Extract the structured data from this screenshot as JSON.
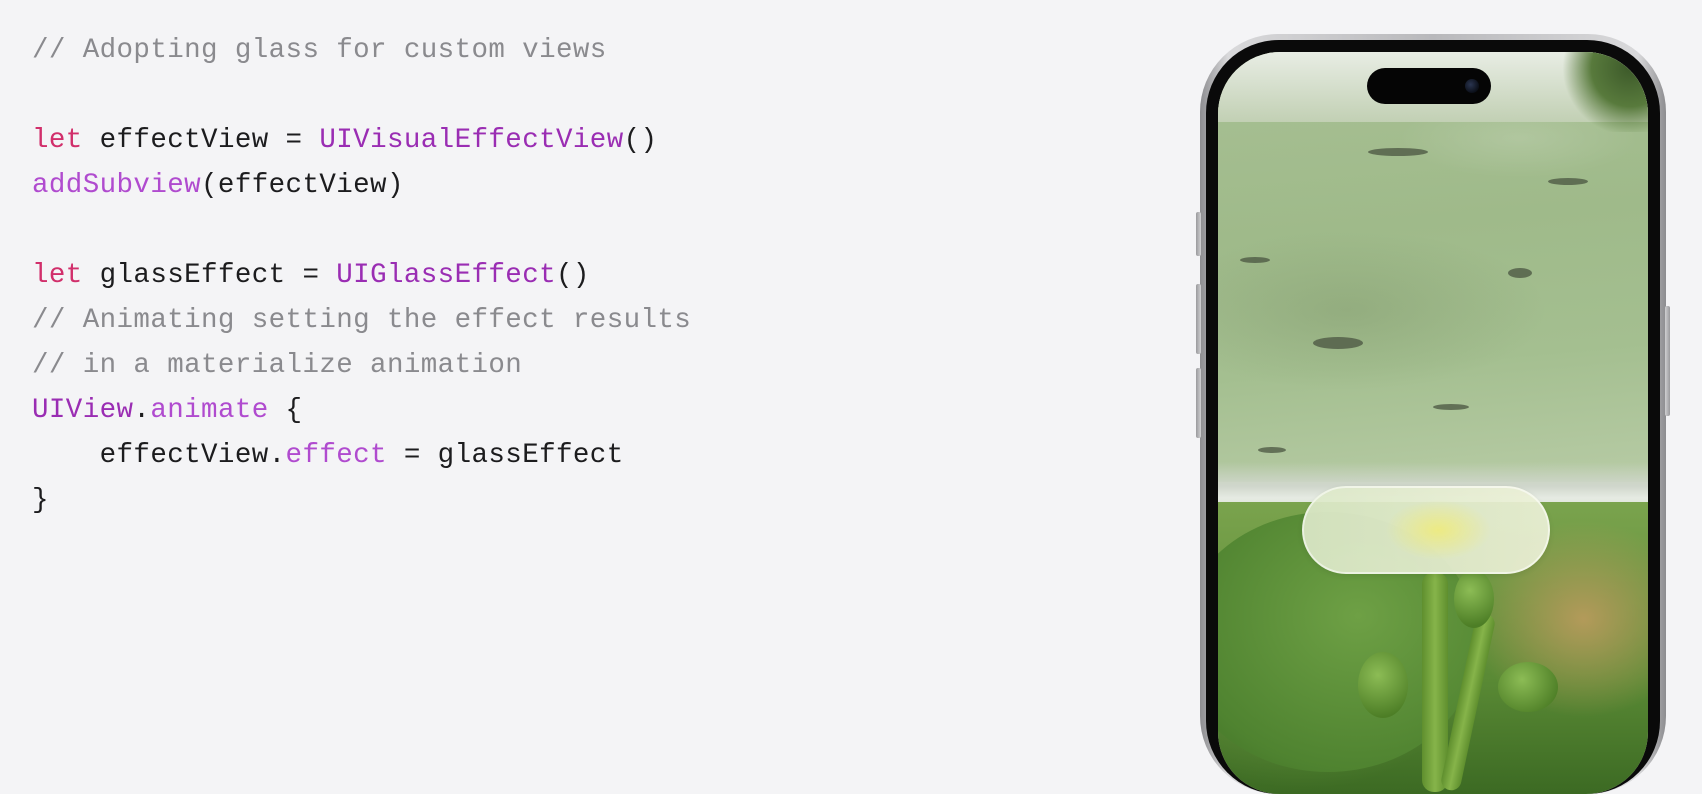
{
  "code": {
    "lines": [
      [
        {
          "t": "// Adopting glass for custom views",
          "c": "comment"
        }
      ],
      [],
      [
        {
          "t": "let",
          "c": "keyword"
        },
        {
          "t": " effectView = ",
          "c": "plain"
        },
        {
          "t": "UIVisualEffectView",
          "c": "type"
        },
        {
          "t": "()",
          "c": "plain"
        }
      ],
      [
        {
          "t": "addSubview",
          "c": "func"
        },
        {
          "t": "(effectView)",
          "c": "plain"
        }
      ],
      [],
      [
        {
          "t": "let",
          "c": "keyword"
        },
        {
          "t": " glassEffect = ",
          "c": "plain"
        },
        {
          "t": "UIGlassEffect",
          "c": "type"
        },
        {
          "t": "()",
          "c": "plain"
        }
      ],
      [
        {
          "t": "// Animating setting the effect results",
          "c": "comment"
        }
      ],
      [
        {
          "t": "// in a materialize animation",
          "c": "comment"
        }
      ],
      [
        {
          "t": "UIView",
          "c": "type"
        },
        {
          "t": ".",
          "c": "plain"
        },
        {
          "t": "animate",
          "c": "func"
        },
        {
          "t": " {",
          "c": "plain"
        }
      ],
      [
        {
          "t": "    effectView.",
          "c": "plain"
        },
        {
          "t": "effect",
          "c": "func"
        },
        {
          "t": " = glassEffect",
          "c": "plain"
        }
      ],
      [
        {
          "t": "}",
          "c": "plain"
        }
      ]
    ]
  },
  "colors": {
    "background": "#f4f4f6",
    "comment": "#8a8a8e",
    "keyword": "#d12f6b",
    "type": "#9a2db3",
    "func": "#b04bcf",
    "plain": "#1c1c1e"
  },
  "phone": {
    "device": "iPhone",
    "icons": [
      "dynamic-island-icon",
      "camera-icon"
    ]
  }
}
